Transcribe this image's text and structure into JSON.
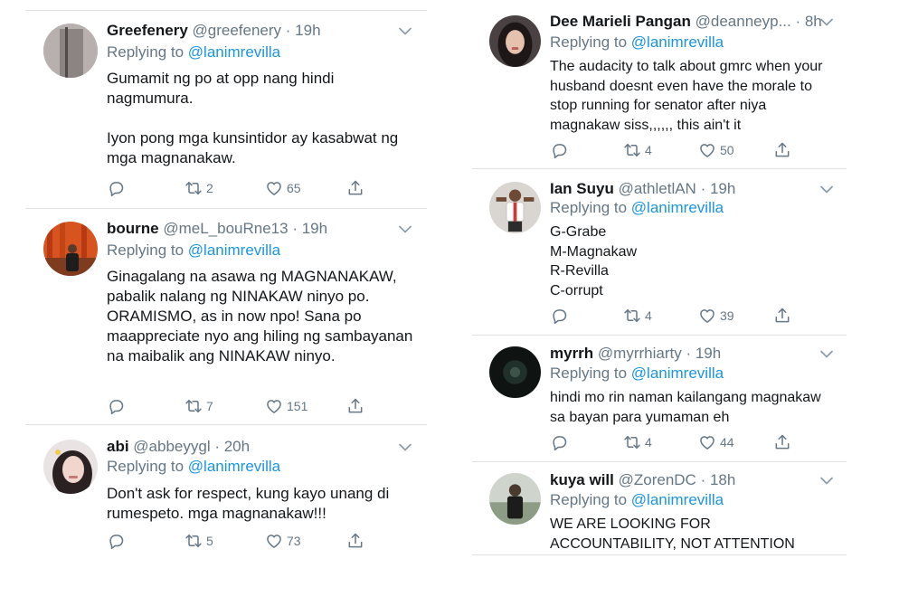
{
  "icons": {
    "reply": "reply-icon",
    "retweet": "retweet-icon",
    "like": "heart-icon",
    "share": "share-icon",
    "menu": "chevron-down-icon"
  },
  "colors": {
    "link": "#1b95e0",
    "secondary": "#657786",
    "text": "#14171a",
    "divider": "#dfe3e6"
  },
  "left_tweets": [
    {
      "name": "Greefenery",
      "handle": "@greefenery",
      "time": "· 19h",
      "replying_prefix": "Replying to",
      "replying_to": "@lanimrevilla",
      "text": "Gumamit ng po at opp nang hindi nagmumura.\n\nIyon pong mga kunsintidor ay kasabwat ng mga magnanakaw.",
      "retweets": "2",
      "likes": "65"
    },
    {
      "name": "bourne",
      "handle": "@meL_bouRne13",
      "time": "· 19h",
      "replying_prefix": "Replying to",
      "replying_to": "@lanimrevilla",
      "text": "Ginagalang na asawa ng MAGNANAKAW, pabalik nalang ng NINAKAW ninyo po. ORAMISMO, as in now npo!  Sana po maappreciate nyo ang hiling ng sambayanan na maibalik ang NINAKAW ninyo.",
      "retweets": "7",
      "likes": "151"
    },
    {
      "name": "abi",
      "handle": "@abbeyygl",
      "time": "· 20h",
      "replying_prefix": "Replying to",
      "replying_to": "@lanimrevilla",
      "text": "Don't ask for respect, kung kayo unang di rumespeto. mga magnanakaw!!!",
      "retweets": "5",
      "likes": "73"
    }
  ],
  "right_tweets": [
    {
      "name": "Dee Marieli Pangan",
      "handle": "@deanneyp...",
      "time": "· 8h",
      "replying_prefix": "Replying to",
      "replying_to": "@lanimrevilla",
      "text": "The audacity to talk about gmrc when your husband doesnt even have the morale to stop running for senator after niya magnakaw siss,,,,,, this ain't it",
      "retweets": "4",
      "likes": "50"
    },
    {
      "name": "Ian Suyu",
      "handle": "@athletlAN",
      "time": "· 19h",
      "replying_prefix": "Replying to",
      "replying_to": "@lanimrevilla",
      "text": "G-Grabe\nM-Magnakaw\nR-Revilla\nC-orrupt",
      "retweets": "4",
      "likes": "39"
    },
    {
      "name": "myrrh",
      "handle": "@myrrhiarty",
      "time": "· 19h",
      "replying_prefix": "Replying to",
      "replying_to": "@lanimrevilla",
      "text": "hindi mo rin naman kailangang magnakaw sa bayan para yumaman eh",
      "retweets": "4",
      "likes": "44"
    },
    {
      "name": "kuya will",
      "handle": "@ZorenDC",
      "time": "· 18h",
      "replying_prefix": "Replying to",
      "replying_to": "@lanimrevilla",
      "text": "WE ARE LOOKING FOR ACCOUNTABILITY, NOT ATTENTION",
      "retweets": "",
      "likes": ""
    }
  ]
}
